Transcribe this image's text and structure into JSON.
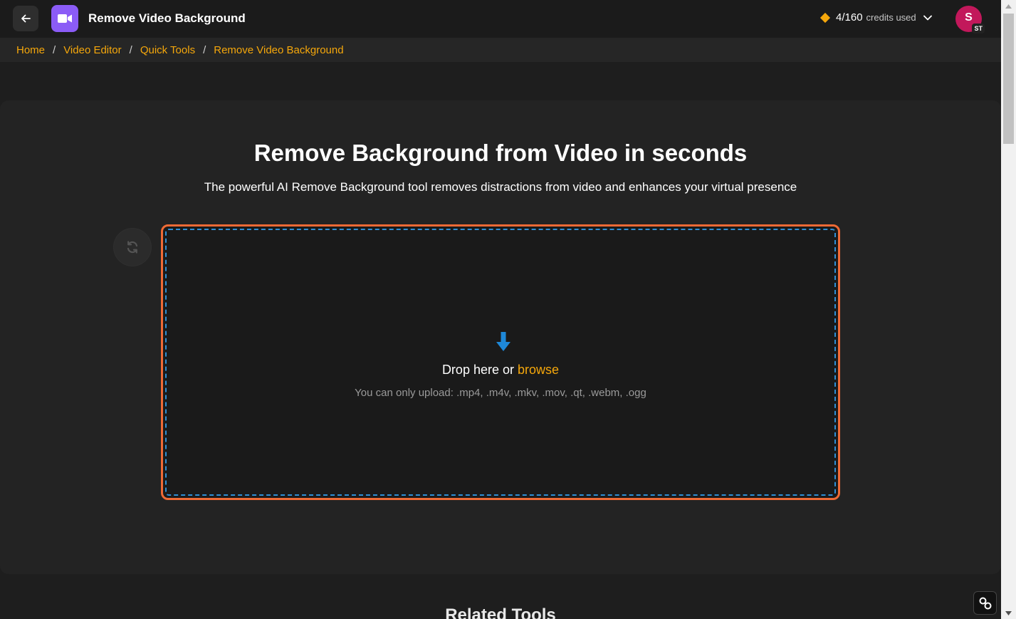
{
  "header": {
    "title": "Remove Video Background",
    "credits_count": "4/160",
    "credits_label": "credits used",
    "avatar_initial": "S",
    "avatar_badge": "ST"
  },
  "breadcrumb": {
    "items": [
      "Home",
      "Video Editor",
      "Quick Tools",
      "Remove Video Background"
    ],
    "separator": "/"
  },
  "hero": {
    "title": "Remove Background from Video in seconds",
    "subtitle": "The powerful AI Remove Background tool removes distractions from video and enhances your virtual presence"
  },
  "dropzone": {
    "prompt": "Drop here or",
    "browse_label": "browse",
    "hint": "You can only upload: .mp4, .m4v, .mkv, .mov, .qt, .webm, .ogg"
  },
  "related": {
    "title": "Related Tools"
  },
  "colors": {
    "accent": "#f5a70b",
    "dropzone_border": "#f06a35",
    "dropzone_dash": "#2f8fd6",
    "app_icon": "#8b5cf6",
    "avatar": "#c2185b"
  },
  "icons": [
    "back-arrow-icon",
    "video-camera-icon",
    "diamond-icon",
    "chevron-down-icon",
    "refresh-icon",
    "download-arrow-icon",
    "link-icon"
  ]
}
